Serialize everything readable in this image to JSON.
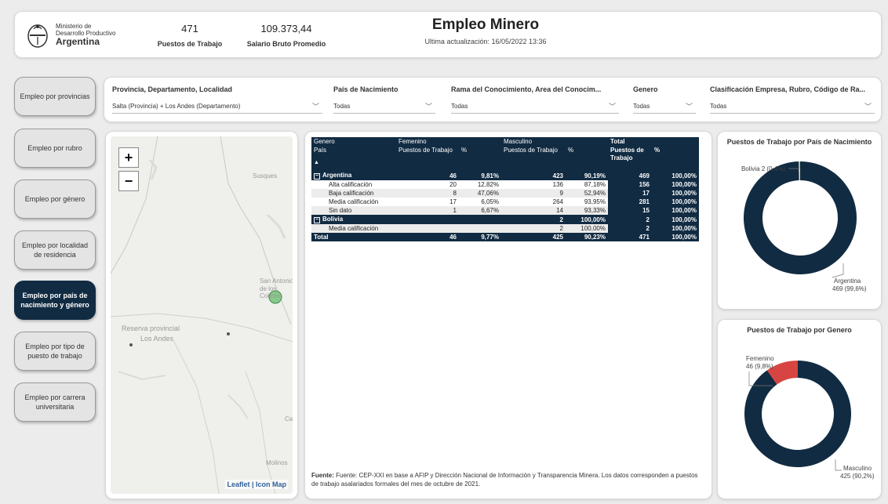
{
  "header": {
    "ministry_line1": "Ministerio de",
    "ministry_line2": "Desarrollo Productivo",
    "ministry_line3": "Argentina",
    "kpi1_value": "471",
    "kpi1_label": "Puestos de Trabajo",
    "kpi2_value": "109.373,44",
    "kpi2_label": "Salario Bruto Promedio",
    "title": "Empleo Minero",
    "subtitle": "Ultima actualización: 16/05/2022 13:36"
  },
  "filters": [
    {
      "label": "Provincia, Departamento, Localidad",
      "value": "Salta (Provincia) + Los Andes (Departamento)"
    },
    {
      "label": "País de Nacimiento",
      "value": "Todas"
    },
    {
      "label": "Rama del Conocimiento, Area del Conocim...",
      "value": "Todas"
    },
    {
      "label": "Genero",
      "value": "Todas"
    },
    {
      "label": "Clasificación Empresa, Rubro, Código de Ra...",
      "value": "Todas"
    }
  ],
  "nav": [
    {
      "label": "Empleo por provincias"
    },
    {
      "label": "Empleo por rubro"
    },
    {
      "label": "Empleo por género"
    },
    {
      "label": "Empleo por localidad de residencia"
    },
    {
      "label": "Empleo por país de nacimiento y género",
      "active": true
    },
    {
      "label": "Empleo por tipo de puesto de trabajo"
    },
    {
      "label": "Empleo por carrera universitaria"
    }
  ],
  "map": {
    "labels": [
      "Susques",
      "San Antonio de los Cobres",
      "Reserva provincial",
      "Los Andes",
      "Ca",
      "Molinos"
    ],
    "zoom_in": "+",
    "zoom_out": "−",
    "attribution": "Leaflet | Icon Map"
  },
  "table": {
    "col_genero": "Genero",
    "col_femenino": "Femenino",
    "col_masculino": "Masculino",
    "col_total": "Total",
    "row_pais": "País",
    "sub_puestos": "Puestos de Trabajo",
    "sub_pct": "%",
    "sub_total_puestos": "Puestos de Trabajo",
    "rows": [
      {
        "kind": "group",
        "name": "Argentina",
        "f_n": "46",
        "f_p": "9,81%",
        "m_n": "423",
        "m_p": "90,19%",
        "t_n": "469",
        "t_p": "100,00%"
      },
      {
        "kind": "sub",
        "name": "Alta calificación",
        "f_n": "20",
        "f_p": "12,82%",
        "m_n": "136",
        "m_p": "87,18%",
        "t_n": "156",
        "t_p": "100,00%"
      },
      {
        "kind": "sub",
        "name": "Baja calificación",
        "f_n": "8",
        "f_p": "47,06%",
        "m_n": "9",
        "m_p": "52,94%",
        "t_n": "17",
        "t_p": "100,00%"
      },
      {
        "kind": "sub",
        "name": "Media calificación",
        "f_n": "17",
        "f_p": "6,05%",
        "m_n": "264",
        "m_p": "93,95%",
        "t_n": "281",
        "t_p": "100,00%"
      },
      {
        "kind": "sub",
        "name": "Sin dato",
        "f_n": "1",
        "f_p": "6,67%",
        "m_n": "14",
        "m_p": "93,33%",
        "t_n": "15",
        "t_p": "100,00%"
      },
      {
        "kind": "group",
        "name": "Bolivia",
        "f_n": "",
        "f_p": "",
        "m_n": "2",
        "m_p": "100,00%",
        "t_n": "2",
        "t_p": "100,00%"
      },
      {
        "kind": "sub",
        "name": "Media calificación",
        "f_n": "",
        "f_p": "",
        "m_n": "2",
        "m_p": "100,00%",
        "t_n": "2",
        "t_p": "100,00%"
      },
      {
        "kind": "total",
        "name": "Total",
        "f_n": "46",
        "f_p": "9,77%",
        "m_n": "425",
        "m_p": "90,23%",
        "t_n": "471",
        "t_p": "100,00%"
      }
    ],
    "source_bold": "Fuente:",
    "source_text": " Fuente: CEP-XXI en base a AFIP y Dirección Nacional de Información y Transparencia Minera. Los datos corresponden a puestos de trabajo asalariados formales del mes de octubre de 2021."
  },
  "chart_data": [
    {
      "type": "pie",
      "title": "Puestos de Trabajo por País de Nacimiento",
      "categories": [
        "Argentina",
        "Bolivia"
      ],
      "values": [
        469,
        2
      ],
      "labels": [
        "Argentina",
        "Bolivia 2 (0,4%)"
      ],
      "label_values": [
        "469 (99,6%)",
        ""
      ],
      "colors": [
        "#112b42",
        "#e8e2a8"
      ]
    },
    {
      "type": "pie",
      "title": "Puestos de Trabajo por Genero",
      "categories": [
        "Masculino",
        "Femenino"
      ],
      "values": [
        425,
        46
      ],
      "labels": [
        "Masculino",
        "Femenino"
      ],
      "label_values": [
        "425 (90,2%)",
        "46 (9,8%)"
      ],
      "colors": [
        "#112b42",
        "#d64541"
      ]
    }
  ]
}
